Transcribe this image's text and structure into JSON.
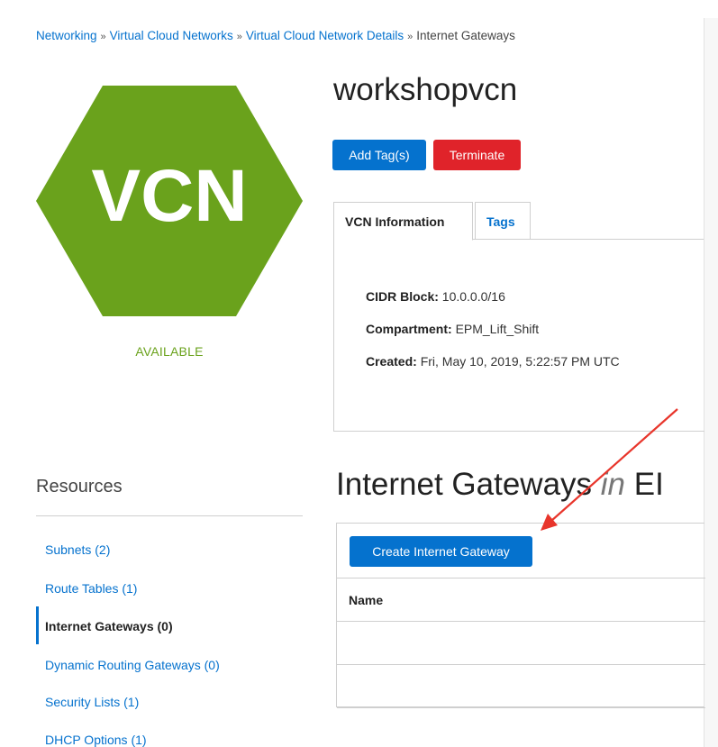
{
  "breadcrumb": {
    "items": [
      "Networking",
      "Virtual Cloud Networks",
      "Virtual Cloud Network Details"
    ],
    "separator": "»",
    "current": "Internet Gateways"
  },
  "vcn": {
    "badge_text": "VCN",
    "badge_color": "#6aa21c",
    "status": "AVAILABLE",
    "name": "workshopvcn"
  },
  "actions": {
    "add_tags": "Add Tag(s)",
    "terminate": "Terminate"
  },
  "tabs": [
    {
      "label": "VCN Information",
      "active": true
    },
    {
      "label": "Tags",
      "active": false
    }
  ],
  "info": {
    "cidr_label": "CIDR Block:",
    "cidr_value": "10.0.0.0/16",
    "compartment_label": "Compartment:",
    "compartment_value": "EPM_Lift_Shift",
    "created_label": "Created:",
    "created_value": "Fri, May 10, 2019, 5:22:57 PM UTC"
  },
  "resources": {
    "heading": "Resources",
    "items": [
      {
        "label": "Subnets (2)",
        "active": false
      },
      {
        "label": "Route Tables (1)",
        "active": false
      },
      {
        "label": "Internet Gateways (0)",
        "active": true
      },
      {
        "label": "Dynamic Routing Gateways (0)",
        "active": false
      },
      {
        "label": "Security Lists (1)",
        "active": false
      },
      {
        "label": "DHCP Options (1)",
        "active": false
      }
    ]
  },
  "section": {
    "title_main": "Internet Gateways",
    "title_in": "in",
    "title_rest": "EI",
    "create_button": "Create Internet Gateway",
    "columns": [
      "Name"
    ]
  },
  "colors": {
    "link_blue": "#0572ce",
    "danger_red": "#e0232a",
    "annotation_arrow": "#e8352b"
  }
}
